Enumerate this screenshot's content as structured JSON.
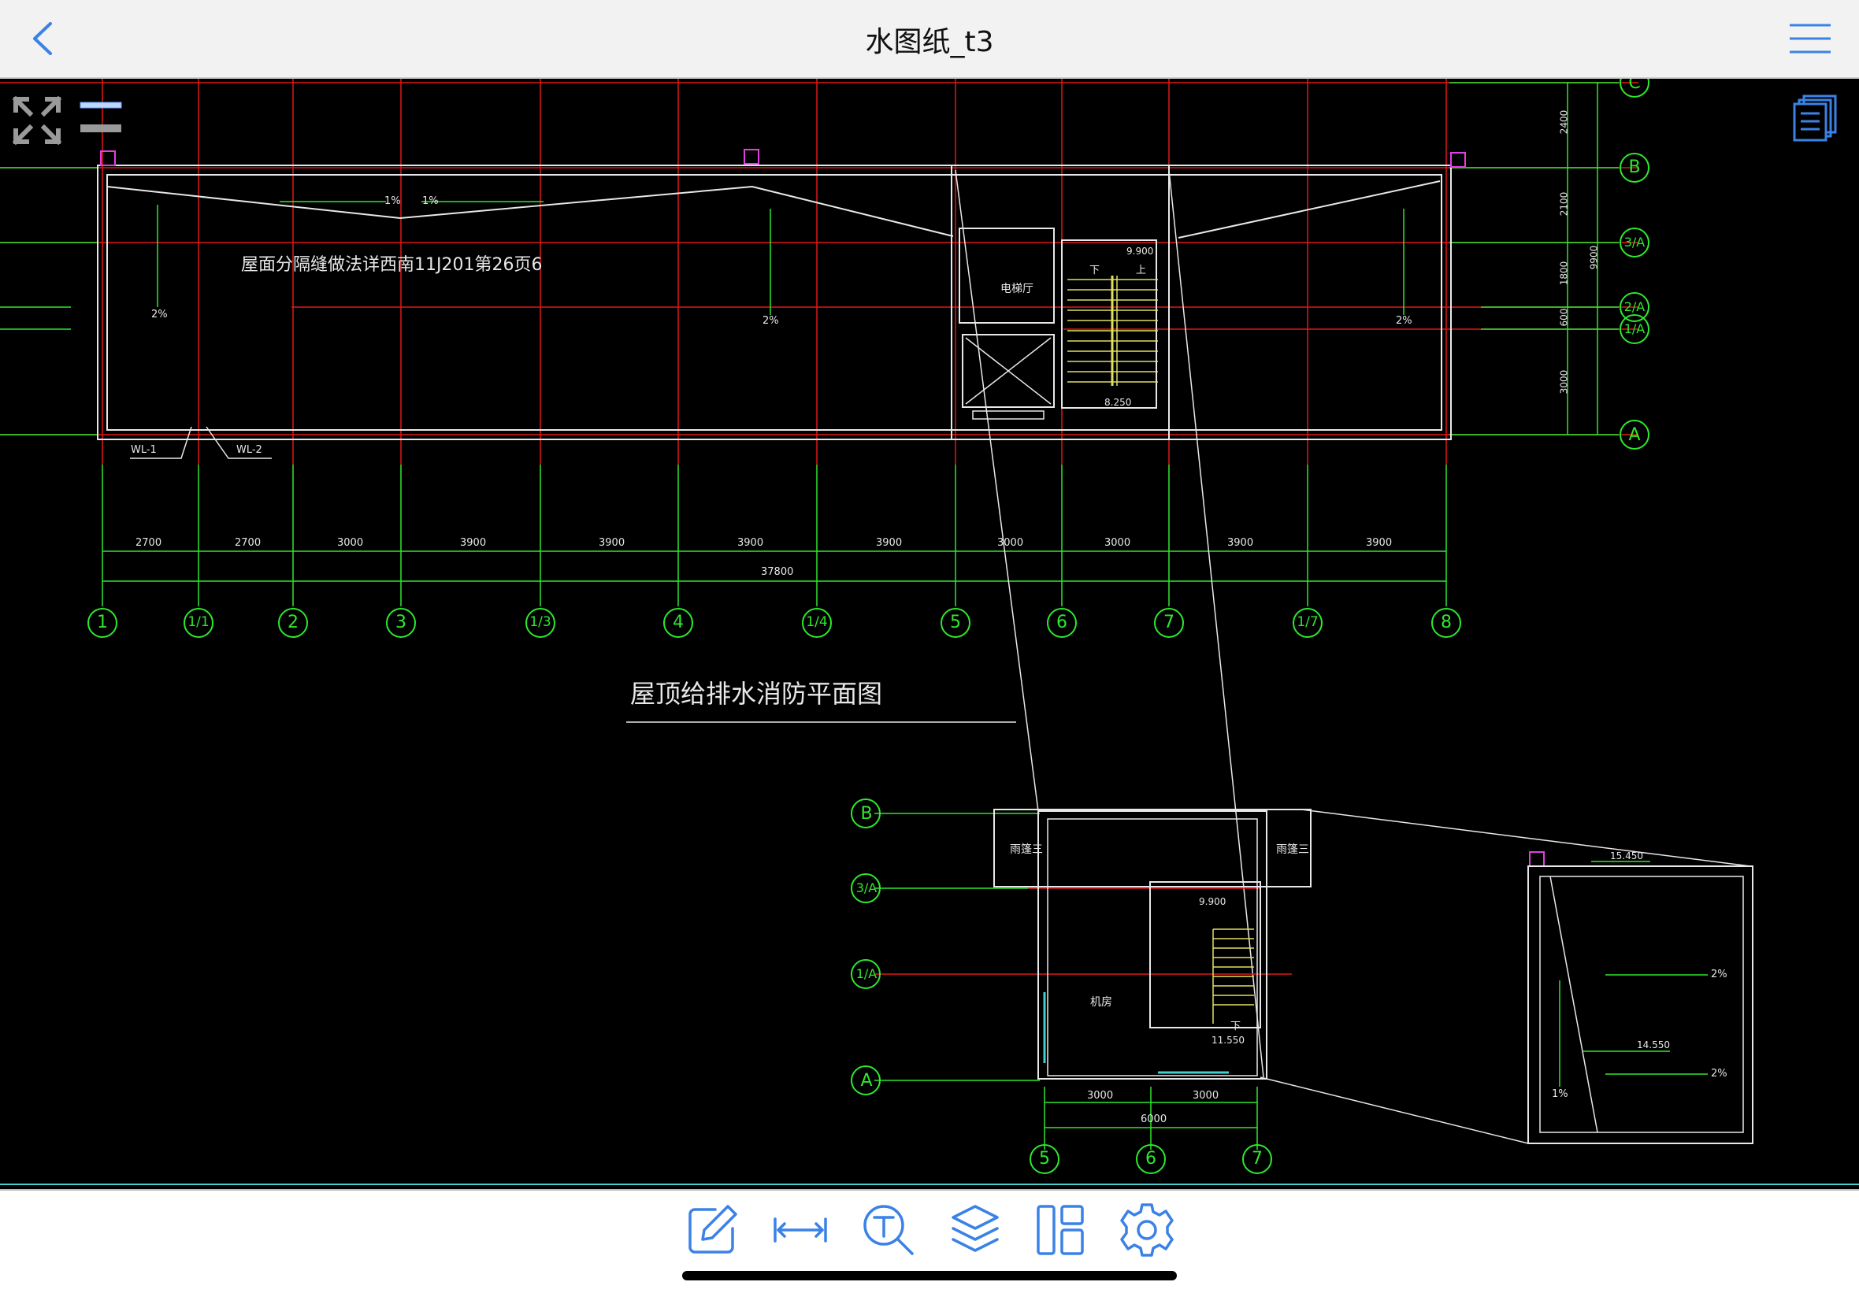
{
  "header": {
    "title": "水图纸_t3"
  },
  "icons": {
    "back": "chevron-left-icon",
    "menu": "hamburger-menu-icon",
    "expand": "expand-arrows-icon",
    "layers_toggle": "two-bars-icon",
    "documents": "documents-stack-icon"
  },
  "toolbar": {
    "items": [
      {
        "icon": "edit-icon"
      },
      {
        "icon": "measure-icon"
      },
      {
        "icon": "text-search-icon"
      },
      {
        "icon": "layers-icon"
      },
      {
        "icon": "layout-icon"
      },
      {
        "icon": "settings-gear-icon"
      }
    ]
  },
  "colors": {
    "accent": "#3b82e6",
    "canvas": "#000000",
    "grid_red": "#e01818",
    "dim_green": "#2ee82e",
    "wall_white": "#e8e8e8",
    "stair_yellow": "#e0e060",
    "magenta": "#e040e0",
    "cyan": "#40d0d0"
  },
  "drawing": {
    "note": "屋面分隔缝做法详西南11J201第26页6",
    "plan_title": "屋顶给排水消防平面图",
    "axis_bubbles_bottom": [
      "1",
      "1/1",
      "2",
      "3",
      "1/3",
      "4",
      "1/4",
      "5",
      "6",
      "7",
      "1/7",
      "8"
    ],
    "axis_bubbles_right": [
      "C",
      "B",
      "3/A",
      "2/A",
      "1/A",
      "A"
    ],
    "dims_bottom": [
      "2700",
      "2700",
      "3000",
      "3900",
      "3900",
      "3900",
      "3900",
      "3000",
      "3000",
      "3900",
      "3900"
    ],
    "dim_total": "37800",
    "dims_right": [
      "2400",
      "2100",
      "1800",
      "600",
      "3000"
    ],
    "dim_right_total": "9900",
    "slopes": [
      "1%",
      "1%",
      "2%",
      "2%",
      "2%"
    ],
    "pipes": [
      "WL-1",
      "WL-2"
    ],
    "rooms": {
      "elevator_hall": "电梯厅",
      "machine_room": "机房",
      "canopy_left": "雨篷三",
      "canopy_right": "雨篷三"
    },
    "stairs": {
      "down": "下",
      "up": "上",
      "down2": "下"
    },
    "elevations": [
      "9.900",
      "8.250",
      "9.900",
      "11.550",
      "15.450",
      "14.550"
    ],
    "detail_axis_left": [
      "B",
      "3/A",
      "1/A",
      "A"
    ],
    "detail_axis_bottom": [
      "5",
      "6",
      "7"
    ],
    "detail_dims": [
      "3000",
      "3000"
    ],
    "detail_dim_total": "6000",
    "detail_slopes": [
      "2%",
      "2%",
      "1%"
    ]
  }
}
